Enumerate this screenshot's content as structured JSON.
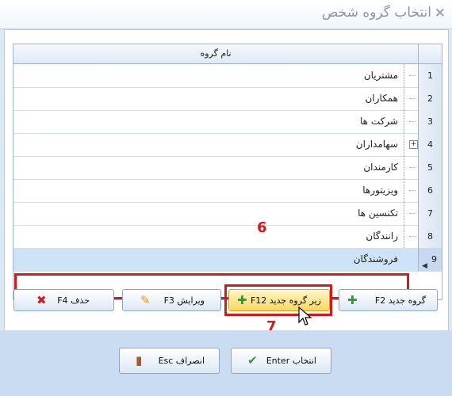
{
  "title": "انتخاب گروه شخص",
  "close_icon": "close-icon",
  "grid": {
    "column_header": "نام گروه",
    "rows": [
      {
        "index": "1",
        "name": "مشتریان",
        "expandable": false,
        "selected": false
      },
      {
        "index": "2",
        "name": "همکاران",
        "expandable": false,
        "selected": false
      },
      {
        "index": "3",
        "name": "شرکت ها",
        "expandable": false,
        "selected": false
      },
      {
        "index": "4",
        "name": "سهامداران",
        "expandable": true,
        "selected": false
      },
      {
        "index": "5",
        "name": "کارمندان",
        "expandable": false,
        "selected": false
      },
      {
        "index": "6",
        "name": "ویزیتورها",
        "expandable": false,
        "selected": false
      },
      {
        "index": "7",
        "name": "تکنسین ها",
        "expandable": false,
        "selected": false
      },
      {
        "index": "8",
        "name": "رانندگان",
        "expandable": false,
        "selected": false
      },
      {
        "index": "9",
        "name": "فروشندگان",
        "expandable": false,
        "selected": true
      }
    ]
  },
  "buttons": {
    "new_group": "گروه جدید F2",
    "new_subgroup": "زیر گروه جدید F12",
    "edit": "ویرایش F3",
    "delete": "حذف F4",
    "select": "انتخاب Enter",
    "cancel": "انصراف Esc"
  },
  "callouts": {
    "row_marker": "6",
    "button_marker": "7"
  },
  "colors": {
    "highlight": "#d11b1b",
    "accent_yellow": "#fbd75b",
    "plus_green": "#2e9b2e"
  }
}
